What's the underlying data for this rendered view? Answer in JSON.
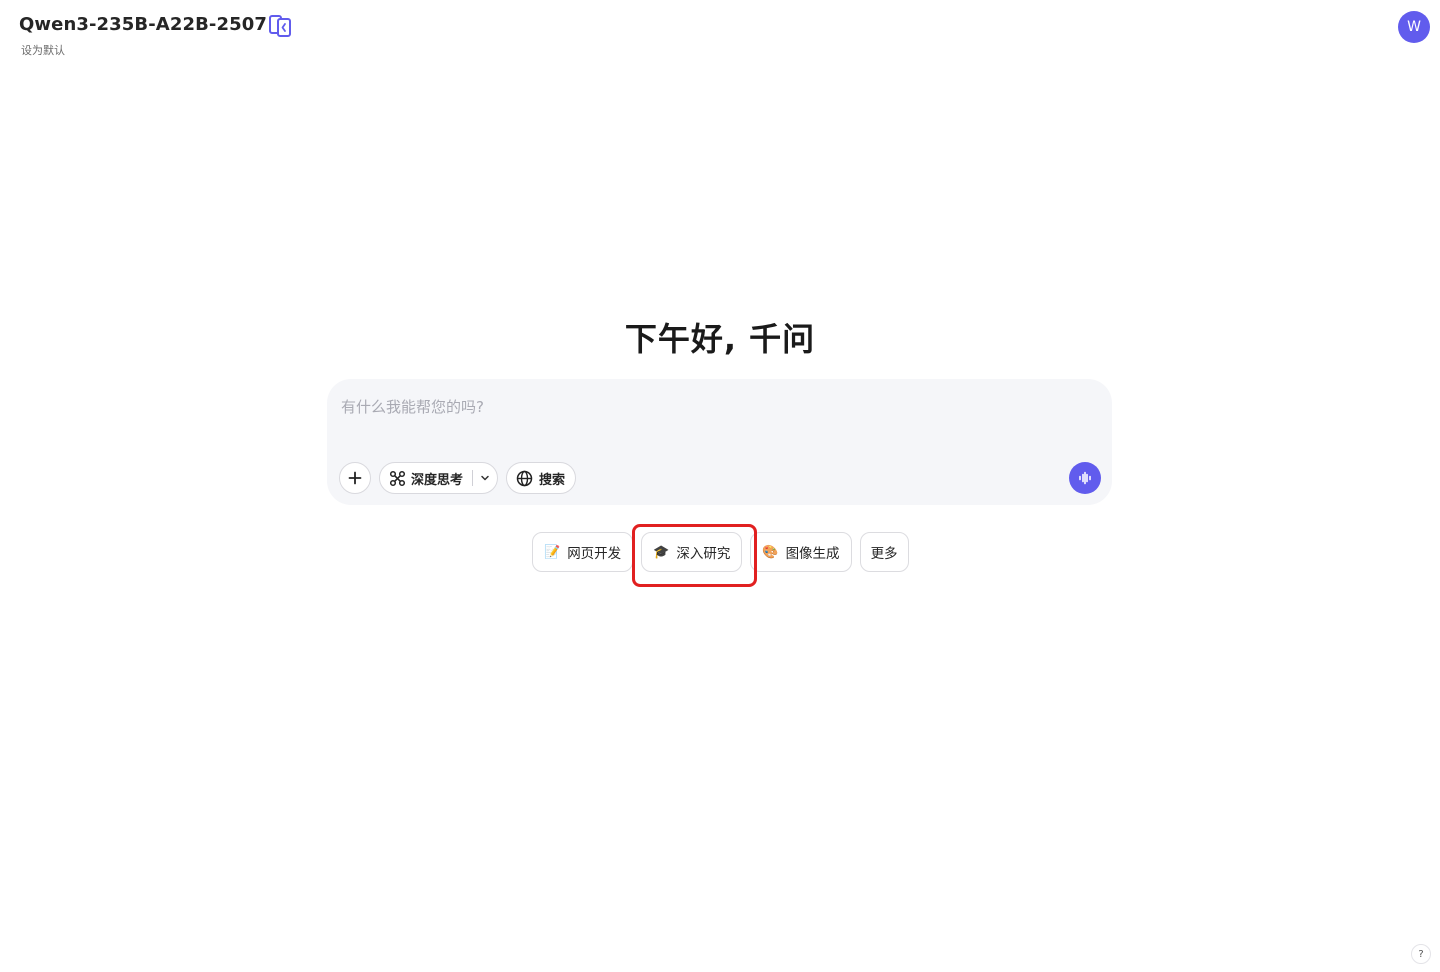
{
  "header": {
    "model_name": "Qwen3-235B-A22B-2507",
    "set_default": "设为默认",
    "avatar_initial": "W"
  },
  "main": {
    "greeting": "下午好, 千问"
  },
  "composer": {
    "placeholder": "有什么我能帮您的吗?",
    "deep_think_label": "深度思考",
    "search_label": "搜索"
  },
  "suggestions": [
    {
      "emoji": "📝",
      "label": "网页开发"
    },
    {
      "emoji": "🎓",
      "label": "深入研究"
    },
    {
      "emoji": "🎨",
      "label": "图像生成"
    },
    {
      "emoji": "",
      "label": "更多"
    }
  ],
  "help": {
    "label": "?"
  },
  "colors": {
    "accent": "#615ced",
    "highlight": "#e12020"
  }
}
